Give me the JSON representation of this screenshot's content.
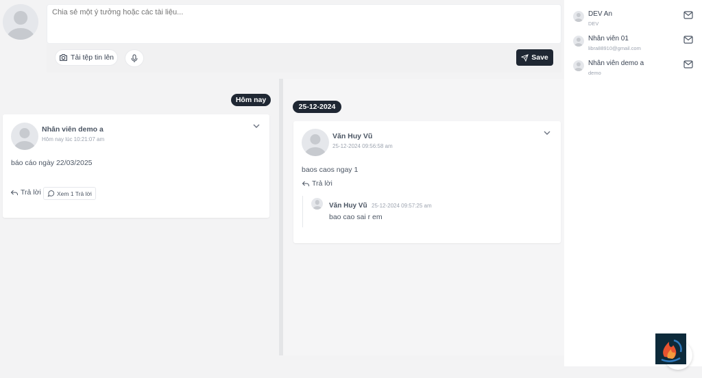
{
  "composer": {
    "placeholder": "Chia sẻ một ý tưởng hoặc các tài liệu...",
    "upload_label": "Tải tệp tin lên",
    "save_label": "Save"
  },
  "timeline": {
    "today_label": "Hôm nay",
    "date_label": "25-12-2024"
  },
  "posts": [
    {
      "author": "Nhân viên demo a",
      "time": "Hôm nay lúc 10:21:07 am",
      "body": "báo cáo ngày 22/03/2025",
      "reply_label": "Trả lời",
      "view_replies_label": "Xem 1 Trả lời"
    },
    {
      "author": "Văn Huy Vũ",
      "time": "25-12-2024 09:56:58 am",
      "body": "baos caos ngay 1",
      "reply_label": "Trả lời",
      "reply": {
        "author": "Văn Huy Vũ",
        "time": "25-12-2024 09:57:25 am",
        "body": "bao cao sai r em"
      }
    }
  ],
  "contacts": [
    {
      "name": "DEV An",
      "sub": "DEV"
    },
    {
      "name": "Nhân viên 01",
      "sub": "libra88910@gmail.com"
    },
    {
      "name": "Nhân viên demo a",
      "sub": "demo"
    }
  ],
  "colors": {
    "dark": "#1f2733",
    "background": "#f3f3f4",
    "card": "#ffffff"
  }
}
